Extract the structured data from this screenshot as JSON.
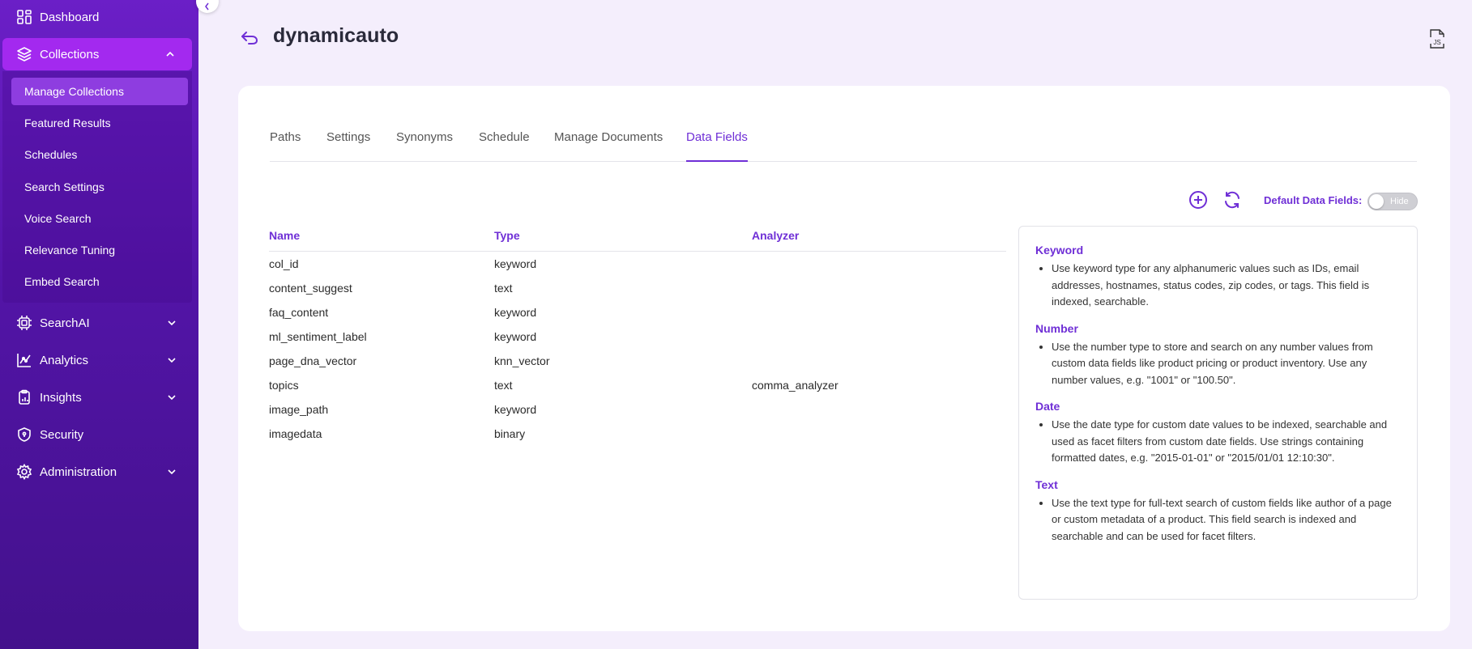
{
  "sidebar": {
    "dashboard": "Dashboard",
    "collections": "Collections",
    "sub_items": [
      "Manage Collections",
      "Featured Results",
      "Schedules",
      "Search Settings",
      "Voice Search",
      "Relevance Tuning",
      "Embed Search"
    ],
    "searchai": "SearchAI",
    "analytics": "Analytics",
    "insights": "Insights",
    "security": "Security",
    "administration": "Administration"
  },
  "header": {
    "title": "dynamicauto"
  },
  "tabs": [
    "Paths",
    "Settings",
    "Synonyms",
    "Schedule",
    "Manage Documents",
    "Data Fields"
  ],
  "toolbar": {
    "default_label": "Default Data Fields:",
    "toggle_label": "Hide"
  },
  "table": {
    "headers": [
      "Name",
      "Type",
      "Analyzer"
    ],
    "rows": [
      [
        "col_id",
        "keyword",
        ""
      ],
      [
        "content_suggest",
        "text",
        ""
      ],
      [
        "faq_content",
        "keyword",
        ""
      ],
      [
        "ml_sentiment_label",
        "keyword",
        ""
      ],
      [
        "page_dna_vector",
        "knn_vector",
        ""
      ],
      [
        "topics",
        "text",
        "comma_analyzer"
      ],
      [
        "image_path",
        "keyword",
        ""
      ],
      [
        "imagedata",
        "binary",
        ""
      ]
    ]
  },
  "info": {
    "sections": [
      {
        "title": "Keyword",
        "text": "Use keyword type for any alphanumeric values such as IDs, email addresses, hostnames, status codes, zip codes, or tags. This field is indexed, searchable."
      },
      {
        "title": "Number",
        "text": "Use the number type to store and search on any number values from custom data fields like product pricing or product inventory. Use any number values, e.g. \"1001\" or \"100.50\"."
      },
      {
        "title": "Date",
        "text": "Use the date type for custom date values to be indexed, searchable and used as facet filters from custom date fields. Use strings containing formatted dates, e.g. \"2015-01-01\" or \"2015/01/01 12:10:30\"."
      },
      {
        "title": "Text",
        "text": "Use the text type for full-text search of custom fields like author of a page or custom metadata of a product. This field search is indexed and searchable and can be used for facet filters."
      }
    ]
  },
  "colors": {
    "accent": "#6f2fd6",
    "sidebar_active": "#a329ef"
  }
}
